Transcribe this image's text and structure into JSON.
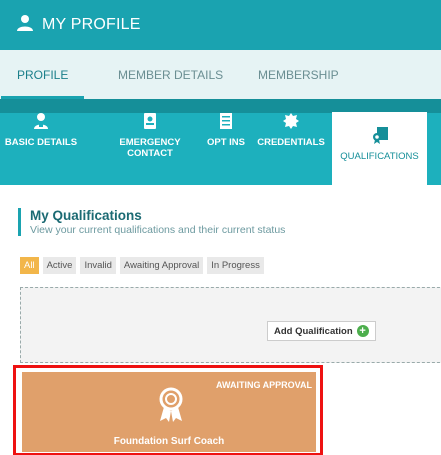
{
  "header": {
    "title": "MY PROFILE",
    "icon": "user-icon"
  },
  "tabs": [
    {
      "label": "PROFILE",
      "active": true
    },
    {
      "label": "MEMBER DETAILS",
      "active": false
    },
    {
      "label": "MEMBERSHIP",
      "active": false
    }
  ],
  "subnav": [
    {
      "label": "BASIC DETAILS",
      "icon": "person-id-icon"
    },
    {
      "label": "EMERGENCY CONTACT",
      "icon": "contact-card-icon"
    },
    {
      "label": "OPT INS",
      "icon": "checklist-icon"
    },
    {
      "label": "CREDENTIALS",
      "icon": "badge-icon"
    },
    {
      "label": "QUALIFICATIONS",
      "icon": "certificate-icon",
      "active": true
    }
  ],
  "section": {
    "title": "My Qualifications",
    "subtitle": "View your current qualifications and their current status"
  },
  "filters": [
    {
      "label": "All",
      "active": true
    },
    {
      "label": "Active"
    },
    {
      "label": "Invalid"
    },
    {
      "label": "Awaiting Approval"
    },
    {
      "label": "In Progress"
    }
  ],
  "add_button": {
    "label": "Add Qualification"
  },
  "qualification_card": {
    "status": "AWAITING APPROVAL",
    "name": "Foundation Surf Coach",
    "color": "#e0a06b"
  },
  "colors": {
    "primary": "#1aa3b0",
    "accent": "#f2b64a",
    "highlight": "#ee1111"
  }
}
